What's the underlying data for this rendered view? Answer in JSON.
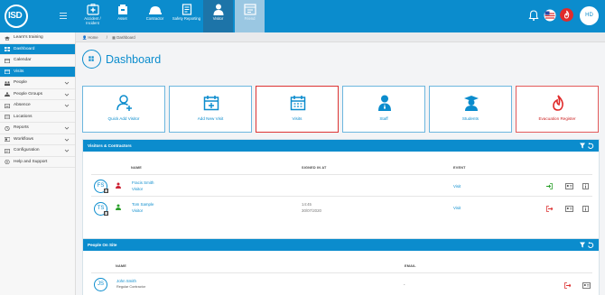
{
  "colors": {
    "brand": "#0b8ccd",
    "evac": "#e02b2b",
    "selected_border": "#d33333"
  },
  "logo": {
    "text": "ISD"
  },
  "modules": [
    {
      "label": "Accident / Incident",
      "icon": "first-aid-icon"
    },
    {
      "label": "Asset",
      "icon": "asset-icon"
    },
    {
      "label": "Contractor",
      "icon": "hard-hat-icon"
    },
    {
      "label": "Safety Reporting",
      "icon": "safety-report-icon"
    },
    {
      "label": "Visitor",
      "icon": "visitor-icon"
    },
    {
      "label": "Friend",
      "icon": "friend-icon"
    }
  ],
  "user": {
    "initials": "HD"
  },
  "sidebar": {
    "items": [
      {
        "label": "Learn's training",
        "icon": "graduation-icon",
        "expandable": false
      },
      {
        "label": "Dashboard",
        "icon": "dashboard-icon",
        "expandable": false,
        "active": true
      },
      {
        "label": "Calendar",
        "icon": "calendar-icon",
        "expandable": false
      },
      {
        "label": "Visits",
        "icon": "visits-icon",
        "expandable": false,
        "active": true
      },
      {
        "label": "People",
        "icon": "people-icon",
        "expandable": true
      },
      {
        "label": "People Groups",
        "icon": "people-groups-icon",
        "expandable": true
      },
      {
        "label": "Absence",
        "icon": "absence-icon",
        "expandable": true
      },
      {
        "label": "Locations",
        "icon": "location-icon",
        "expandable": false
      },
      {
        "label": "Reports",
        "icon": "reports-icon",
        "expandable": true
      },
      {
        "label": "Workflows",
        "icon": "workflows-icon",
        "expandable": true
      },
      {
        "label": "Configuration",
        "icon": "configuration-icon",
        "expandable": true
      },
      {
        "label": "Help and Support",
        "icon": "help-icon",
        "expandable": false
      }
    ]
  },
  "breadcrumb": {
    "home": "Home",
    "current": "Dashboard"
  },
  "page": {
    "title": "Dashboard"
  },
  "tiles": [
    {
      "label": "Quick Add Visitor",
      "icon": "add-person-icon"
    },
    {
      "label": "Add New Visit",
      "icon": "calendar-add-icon"
    },
    {
      "label": "Visits",
      "icon": "calendar-icon",
      "selected": true
    },
    {
      "label": "Staff",
      "icon": "staff-icon"
    },
    {
      "label": "Students",
      "icon": "student-icon"
    },
    {
      "label": "Evacuation Register",
      "icon": "fire-icon"
    }
  ],
  "visitors_panel": {
    "title": "Visitors & Contractors",
    "columns": {
      "name": "NAME",
      "signed_in_at": "SIGNED IN AT",
      "event": "EVENT"
    },
    "rows": [
      {
        "initials": "FS",
        "name": "Fracis Smith",
        "type": "Visitor",
        "signed_in_time": "",
        "signed_in_date": "",
        "event": "Visit",
        "status": "signed-out"
      },
      {
        "initials": "TS",
        "name": "Tom Sample",
        "type": "Visitor",
        "signed_in_time": "14:45",
        "signed_in_date": "30/07/2020",
        "event": "Visit",
        "status": "signed-in"
      }
    ]
  },
  "people_panel": {
    "title": "People On Site",
    "columns": {
      "name": "NAME",
      "email": "EMAIL"
    },
    "rows": [
      {
        "initials": "JS",
        "name": "John Smith",
        "type": "Regular Contractor",
        "email": "-"
      }
    ]
  }
}
